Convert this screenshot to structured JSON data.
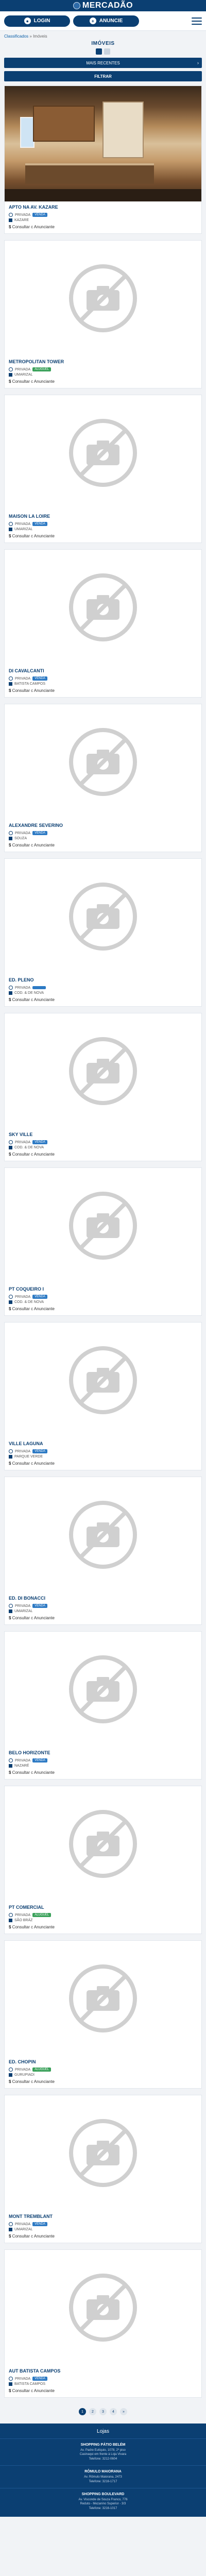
{
  "brand": "MERCADÃO",
  "actions": {
    "login_label": "LOGIN",
    "anuncie_label": "ANUNCIE"
  },
  "breadcrumb": {
    "link": "Classificados",
    "sep": "»",
    "current": "Imóveis"
  },
  "page_title": "IMÓVEIS",
  "sort": {
    "selected": "MAIS RECENTES"
  },
  "filter_label": "FILTRAR",
  "consult_prefix": "$",
  "consult_label": "Consultar c Anunciante",
  "listings": [
    {
      "title": "APTO NA AV. KAZARE",
      "has_photo": true,
      "type": "PRIVADA",
      "badge": "VENDA",
      "badge_color": "blue",
      "location": "KAZARE"
    },
    {
      "title": "METROPOLITAN TOWER",
      "has_photo": false,
      "type": "PRIVADA",
      "badge": "ALUGUEL",
      "badge_color": "green",
      "location": "UMARIZAL"
    },
    {
      "title": "MAISON LA LOIRE",
      "has_photo": false,
      "type": "PRIVADA",
      "badge": "VENDA",
      "badge_color": "blue",
      "location": "UMARIZAL"
    },
    {
      "title": "DI CAVALCANTI",
      "has_photo": false,
      "type": "PRIVADA",
      "badge": "VENDA",
      "badge_color": "blue",
      "location": "BATISTA CAMPOS"
    },
    {
      "title": "ALEXANDRE SEVERINO",
      "has_photo": false,
      "type": "PRIVADA",
      "badge": "VENDA",
      "badge_color": "blue",
      "location": "SOUZA"
    },
    {
      "title": "ED. PLENO",
      "has_photo": false,
      "type": "PRIVADA",
      "badge": "",
      "badge_color": "blue",
      "location": "COD. & DE NOVA"
    },
    {
      "title": "SKY VILLE",
      "has_photo": false,
      "type": "PRIVADA",
      "badge": "VENDA",
      "badge_color": "blue",
      "location": "COD. & DE NOVA"
    },
    {
      "title": "PT COQUEIRO I",
      "has_photo": false,
      "type": "PRIVADA",
      "badge": "VENDA",
      "badge_color": "blue",
      "location": "COD. & DE NOVA"
    },
    {
      "title": "VILLE LAGUNA",
      "has_photo": false,
      "type": "PRIVADA",
      "badge": "VENDA",
      "badge_color": "blue",
      "location": "PARQUE VERDE"
    },
    {
      "title": "ED. DI BONACCI",
      "has_photo": false,
      "type": "PRIVADA",
      "badge": "VENDA",
      "badge_color": "blue",
      "location": "UMARIZAL"
    },
    {
      "title": "BELO HORIZONTE",
      "has_photo": false,
      "type": "PRIVADA",
      "badge": "VENDA",
      "badge_color": "blue",
      "location": "NAZARÉ"
    },
    {
      "title": "PT COMERCIAL",
      "has_photo": false,
      "type": "PRIVADA",
      "badge": "ALUGUEL",
      "badge_color": "green",
      "location": "SÃO BRÁZ"
    },
    {
      "title": "ED. CHOPIN",
      "has_photo": false,
      "type": "PRIVADA",
      "badge": "ALUGUEL",
      "badge_color": "green",
      "location": "GURUPIADI"
    },
    {
      "title": "MONT TREMBLANT",
      "has_photo": false,
      "type": "PRIVADA",
      "badge": "VENDA",
      "badge_color": "blue",
      "location": "UMARIZAL"
    },
    {
      "title": "AUT BATISTA CAMPOS",
      "has_photo": false,
      "type": "PRIVADA",
      "badge": "VENDA",
      "badge_color": "blue",
      "location": "BATISTA CAMPOS"
    }
  ],
  "pagination": [
    "1",
    "2",
    "3",
    "4",
    "»"
  ],
  "footer": {
    "heading": "Lojas",
    "stores": [
      {
        "name": "SHOPPING PÁTIO BELÉM",
        "addr": "Av. Padre Eutíquio, 1078, 2º piso\nCasinaqui em frente à Loja Vivara\nTelefone: 3212-0604"
      },
      {
        "name": "RÔMULO MAIORANA",
        "addr": "Av. Rômulo Maiorana, 2473\nTelefone: 3216-1717"
      },
      {
        "name": "SHOPPING BOULEVARD",
        "addr": "Av. Visconde de Souza Franco, 776\nReduto - Mezanino Superior - 3/3\nTelefone: 3216-1017"
      }
    ]
  },
  "colors": {
    "primary": "#0b3f72",
    "badge_blue": "#2d7ac4",
    "badge_green": "#3aa15a"
  }
}
